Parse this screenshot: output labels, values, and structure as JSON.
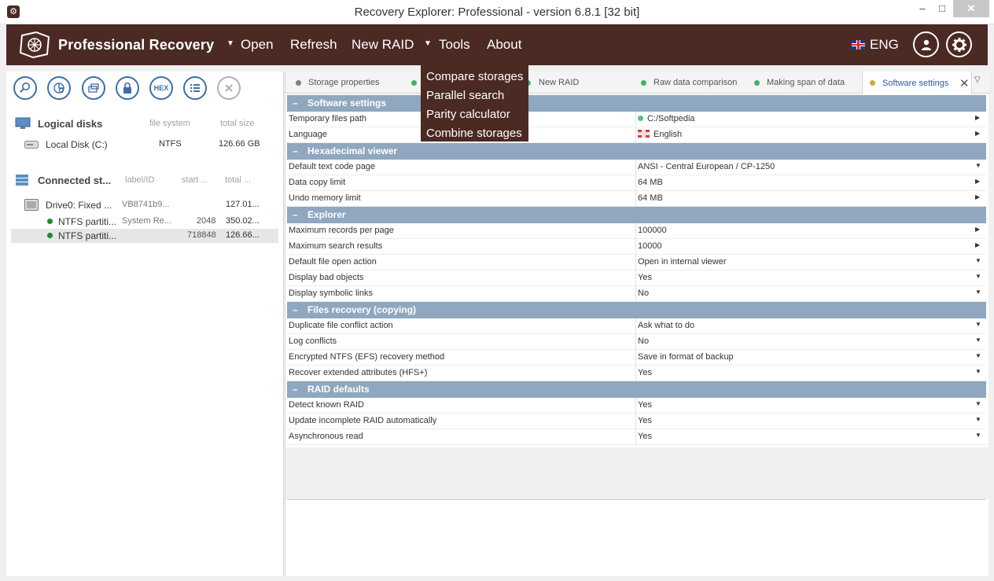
{
  "window": {
    "title": "Recovery Explorer: Professional - version 6.8.1 [32 bit]",
    "minimize": "–",
    "maximize": "□",
    "close": "✕"
  },
  "menubar": {
    "brand": "Professional Recovery",
    "items": [
      "Open",
      "Refresh",
      "New RAID",
      "Tools",
      "About"
    ],
    "language": "ENG",
    "bg_color": "#4b2a23"
  },
  "tools_menu": {
    "items": [
      "Compare storages",
      "Parallel search",
      "Parity calculator",
      "Combine storages"
    ]
  },
  "left": {
    "toolbar": {
      "hex_label": "HEX"
    },
    "logical": {
      "title": "Logical disks",
      "col_fs": "file system",
      "col_size": "total size",
      "rows": [
        {
          "name": "Local Disk (C:)",
          "fs": "NTFS",
          "size": "126.66 GB"
        }
      ]
    },
    "connected": {
      "title": "Connected st...",
      "col_label": "label/ID",
      "col_start": "start ...",
      "col_total": "total ...",
      "rows": [
        {
          "name": "Drive0: Fixed ...",
          "label": "VB8741b9...",
          "start": "",
          "total": "127.01..."
        },
        {
          "name": "NTFS partiti...",
          "label": "System Re...",
          "start": "2048",
          "total": "350.02..."
        },
        {
          "name": "NTFS partiti...",
          "label": "",
          "start": "718848",
          "total": "126.66..."
        }
      ]
    }
  },
  "tabs": [
    {
      "label": "Storage properties",
      "dot": "#808080"
    },
    {
      "label": "",
      "dot": "#3cb371"
    },
    {
      "label": "New RAID",
      "dot": "#3cb371"
    },
    {
      "label": "Raw data comparison",
      "dot": "#3cb371"
    },
    {
      "label": "Making span of data",
      "dot": "#3cb371"
    },
    {
      "label": "Software settings",
      "dot": "#d4aa2e"
    }
  ],
  "settings": {
    "groups": [
      {
        "title": "Software settings",
        "rows": [
          {
            "name": "Temporary files path",
            "value": "C:/Softpedia",
            "control": "▶",
            "marker": "dot"
          },
          {
            "name": "Language",
            "value": "English",
            "control": "▶",
            "marker": "flag"
          }
        ]
      },
      {
        "title": "Hexadecimal viewer",
        "rows": [
          {
            "name": "Default text code page",
            "value": "ANSI - Central European / CP-1250",
            "control": "▼"
          },
          {
            "name": "Data copy limit",
            "value": "64 MB",
            "control": "▶"
          },
          {
            "name": "Undo memory limit",
            "value": "64 MB",
            "control": "▶"
          }
        ]
      },
      {
        "title": "Explorer",
        "rows": [
          {
            "name": "Maximum records per page",
            "value": "100000",
            "control": "▶"
          },
          {
            "name": "Maximum search results",
            "value": "10000",
            "control": "▶"
          },
          {
            "name": "Default file open action",
            "value": "Open in internal viewer",
            "control": "▼"
          },
          {
            "name": "Display bad objects",
            "value": "Yes",
            "control": "▼"
          },
          {
            "name": "Display symbolic links",
            "value": "No",
            "control": "▼"
          }
        ]
      },
      {
        "title": "Files recovery (copying)",
        "rows": [
          {
            "name": "Duplicate file conflict action",
            "value": "Ask what to do",
            "control": "▼"
          },
          {
            "name": "Log conflicts",
            "value": "No",
            "control": "▼"
          },
          {
            "name": "Encrypted NTFS (EFS) recovery method",
            "value": "Save in format of backup",
            "control": "▼"
          },
          {
            "name": "Recover extended attributes (HFS+)",
            "value": "Yes",
            "control": "▼"
          }
        ]
      },
      {
        "title": "RAID defaults",
        "rows": [
          {
            "name": "Detect known RAID",
            "value": "Yes",
            "control": "▼"
          },
          {
            "name": "Update incomplete RAID automatically",
            "value": "Yes",
            "control": "▼"
          },
          {
            "name": "Asynchronous read",
            "value": "Yes",
            "control": "▼"
          }
        ]
      }
    ]
  }
}
